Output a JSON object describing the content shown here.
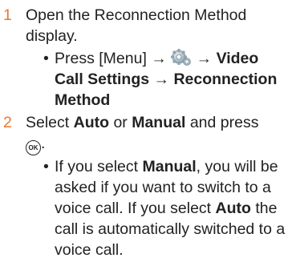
{
  "colors": {
    "step_number": "#E8772E",
    "text": "#222222"
  },
  "steps": [
    {
      "number": "1",
      "line1": "Open the Reconnection Method",
      "line2": "display."
    },
    {
      "number": "2",
      "select": "Select",
      "auto": "Auto",
      "or": "or",
      "manual": "Manual",
      "and_press": "and press"
    }
  ],
  "bullet1": {
    "dot": "•",
    "press": "Press [Menu]",
    "arrow": "→",
    "icon": "settings-gear-icon",
    "video_call_settings": "Video",
    "call_settings": "Call Settings",
    "reconnection": "Reconnection",
    "method": "Method"
  },
  "ok_key": {
    "label": "OK",
    "icon": "ok-key-icon"
  },
  "bullet2": {
    "dot": "•",
    "if_select": "If you select",
    "manual": "Manual",
    "rest1": ", you will be",
    "line2": "asked if you want to switch to a",
    "line3_pre": "voice call. If you select",
    "auto": "Auto",
    "line3_post": "the",
    "line4": "call is automatically switched to a",
    "line5": "voice call."
  }
}
